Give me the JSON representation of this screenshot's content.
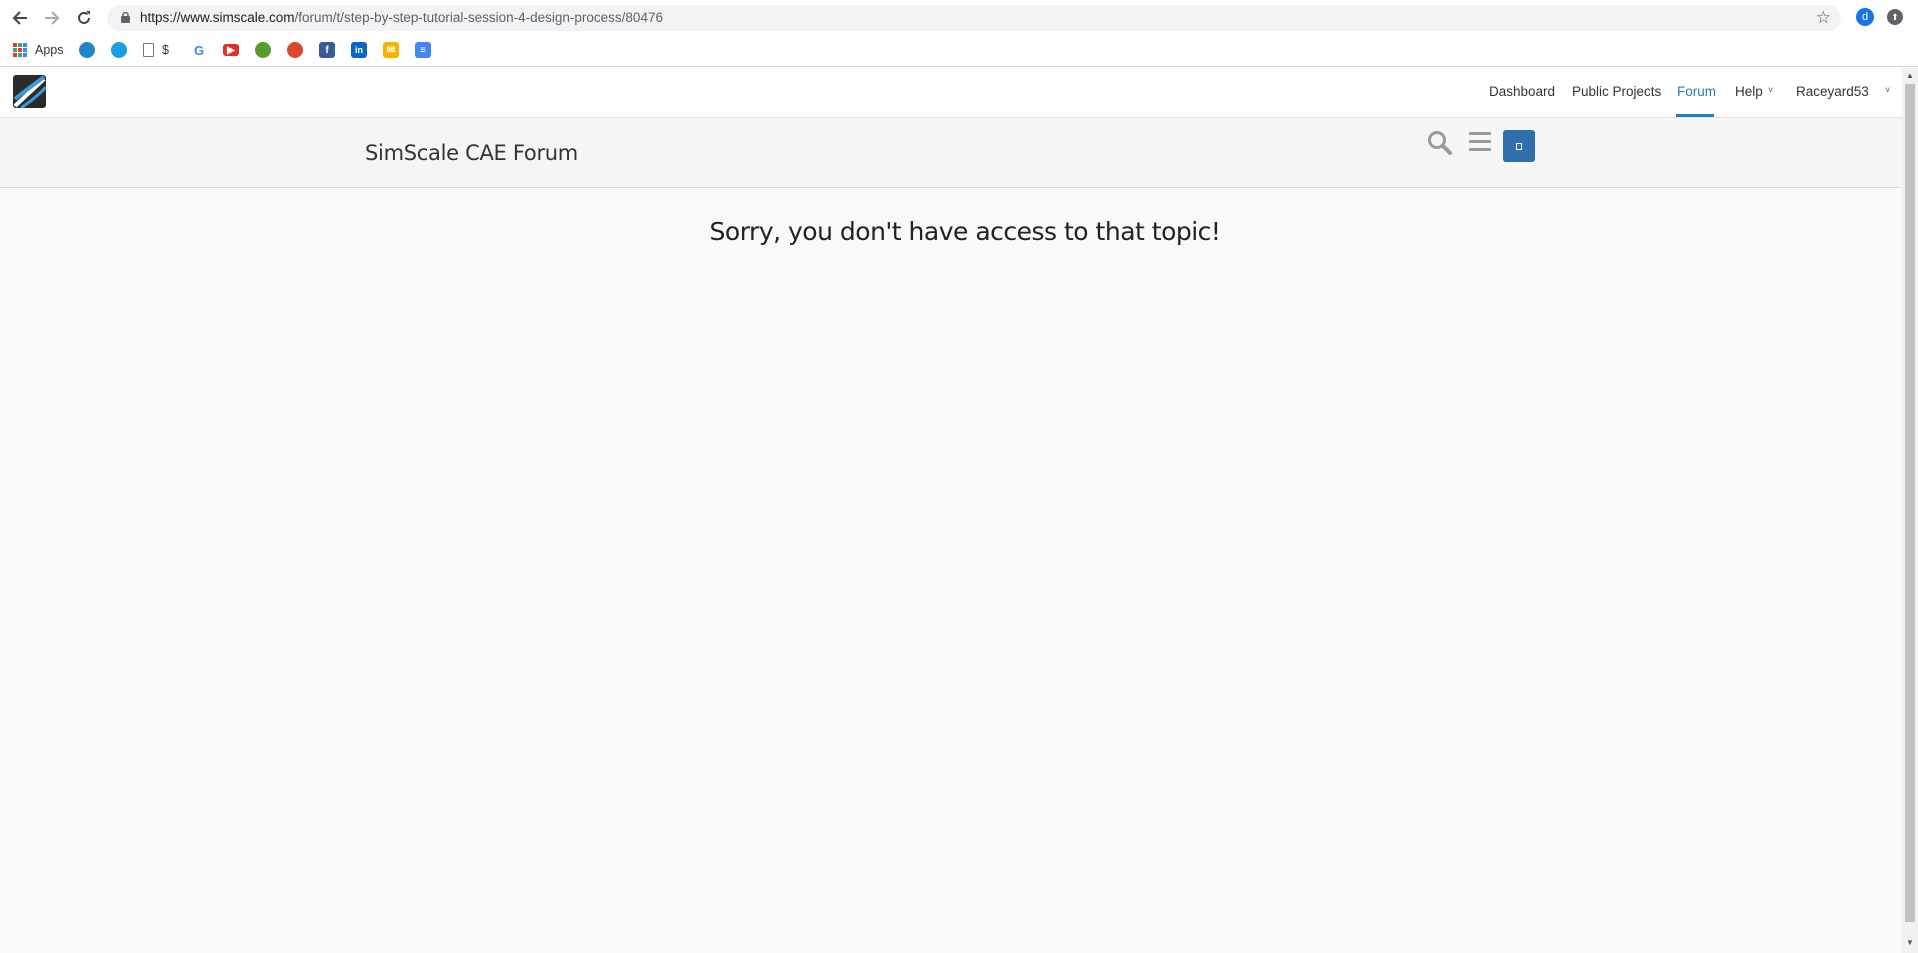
{
  "browser": {
    "url_host": "https://www.simscale.com",
    "url_path": "/forum/t/step-by-step-tutorial-session-4-design-process/80476",
    "profile_initial": "d"
  },
  "bookmarks": {
    "apps_label": "Apps",
    "dollar_label": "$",
    "google_letter": "G"
  },
  "site_nav": {
    "dashboard": "Dashboard",
    "public_projects": "Public Projects",
    "forum": "Forum",
    "help": "Help",
    "user": "Raceyard53",
    "accent_color": "#2a7ab8"
  },
  "forum": {
    "title": "SimScale CAE Forum"
  },
  "main": {
    "message": "Sorry, you don't have access to that topic!"
  }
}
